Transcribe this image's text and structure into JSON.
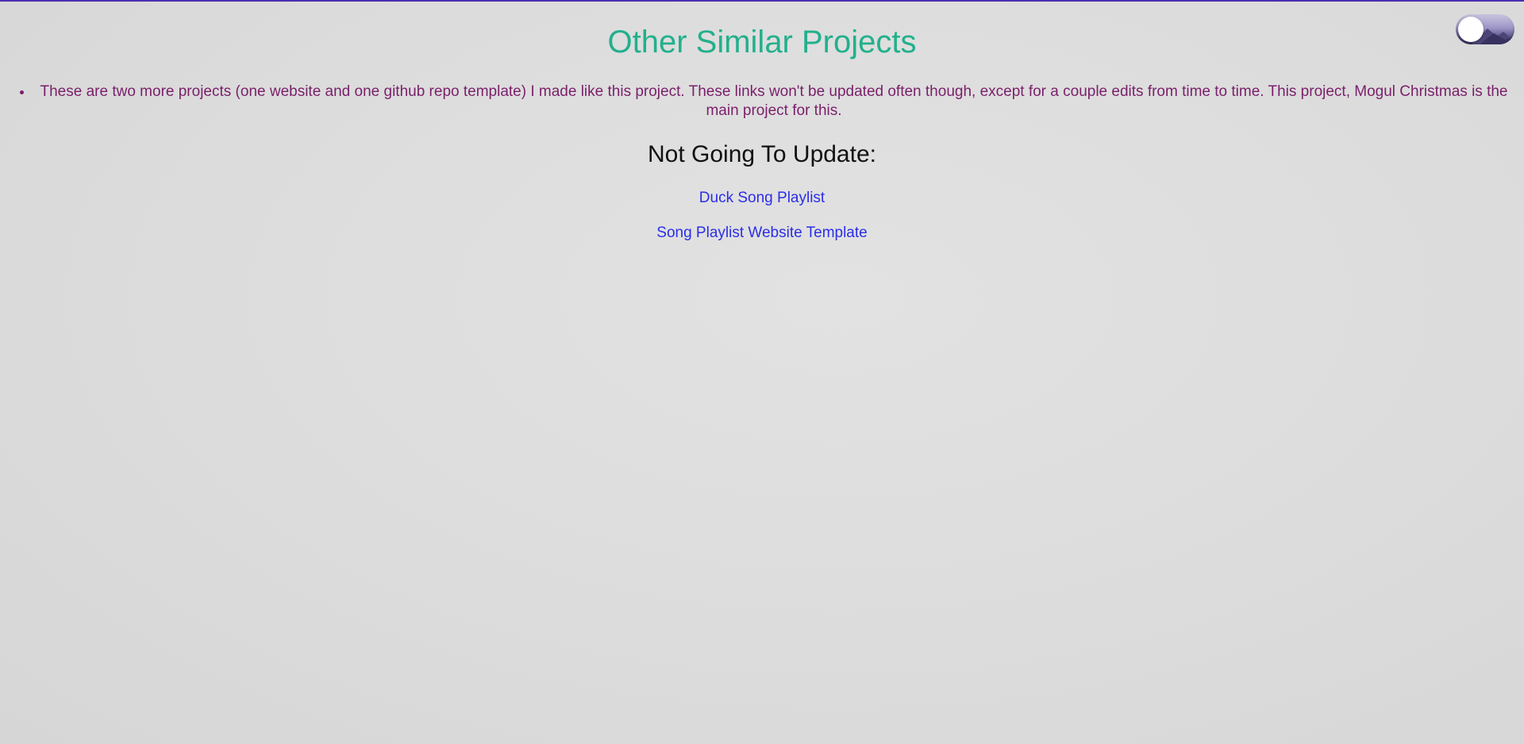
{
  "page": {
    "title": "Other Similar Projects",
    "intro": "These are two more projects (one website and one github repo template) I made like this project. These links won't be updated often though, except for a couple edits from time to time. This project, Mogul Christmas is the main project for this.",
    "section_heading": "Not Going To Update:",
    "links": [
      {
        "label": "Duck Song Playlist"
      },
      {
        "label": "Song Playlist Website Template"
      }
    ]
  },
  "theme_toggle": {
    "icon": "theme-toggle-switch",
    "state": "off"
  },
  "colors": {
    "title": "#22b08c",
    "intro_text": "#7a1f6a",
    "heading": "#111111",
    "link": "#2b2ee6",
    "top_border": "#4a2fb0"
  }
}
